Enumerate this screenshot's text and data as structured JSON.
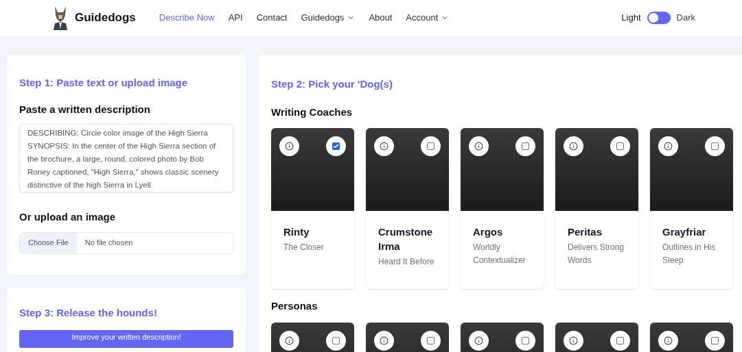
{
  "brand": {
    "name": "Guidedogs"
  },
  "nav": [
    {
      "label": "Describe Now",
      "selected": true,
      "kind": "link"
    },
    {
      "label": "API",
      "selected": false,
      "kind": "link"
    },
    {
      "label": "Contact",
      "selected": false,
      "kind": "link"
    },
    {
      "label": "Guidedogs",
      "selected": false,
      "kind": "dropdown"
    },
    {
      "label": "About",
      "selected": false,
      "kind": "link"
    },
    {
      "label": "Account",
      "selected": false,
      "kind": "dropdown"
    }
  ],
  "theme_toggle": {
    "left_label": "Light",
    "right_label": "Dark",
    "on": false
  },
  "step1": {
    "title": "Step 1: Paste text or upload image",
    "paste_heading": "Paste a written description",
    "description": "DESCRIBING: Circle color image of the High Sierra\nSYNOPSIS: In the center of the High Sierra section of the brochure, a large, round, colored photo by Bob Roney captioned, \"High Sierra,\" shows classic scenery distinctive of the high Sierra in Lyell",
    "upload_heading": "Or upload an image",
    "file_button": "Choose File",
    "file_status": "No file chosen"
  },
  "step3": {
    "title": "Step 3: Release the hounds!",
    "button": "Improve your written description!"
  },
  "step2": {
    "title": "Step 2: Pick your 'Dog(s)",
    "groups": [
      {
        "heading": "Writing Coaches",
        "dogs": [
          {
            "name": "Rinty",
            "tagline": "The Closer",
            "selected": true
          },
          {
            "name": "Crumstone Irma",
            "tagline": "Heard It Before",
            "selected": false
          },
          {
            "name": "Argos",
            "tagline": "Worldly Contextualizer",
            "selected": false
          },
          {
            "name": "Peritas",
            "tagline": "Delivers Strong Words",
            "selected": false
          },
          {
            "name": "Grayfriar",
            "tagline": "Outlines in His Sleep",
            "selected": false
          }
        ]
      },
      {
        "heading": "Personas",
        "dogs": [
          {
            "selected": false
          },
          {
            "selected": false
          },
          {
            "selected": false
          },
          {
            "selected": false
          },
          {
            "selected": false
          }
        ]
      }
    ]
  }
}
